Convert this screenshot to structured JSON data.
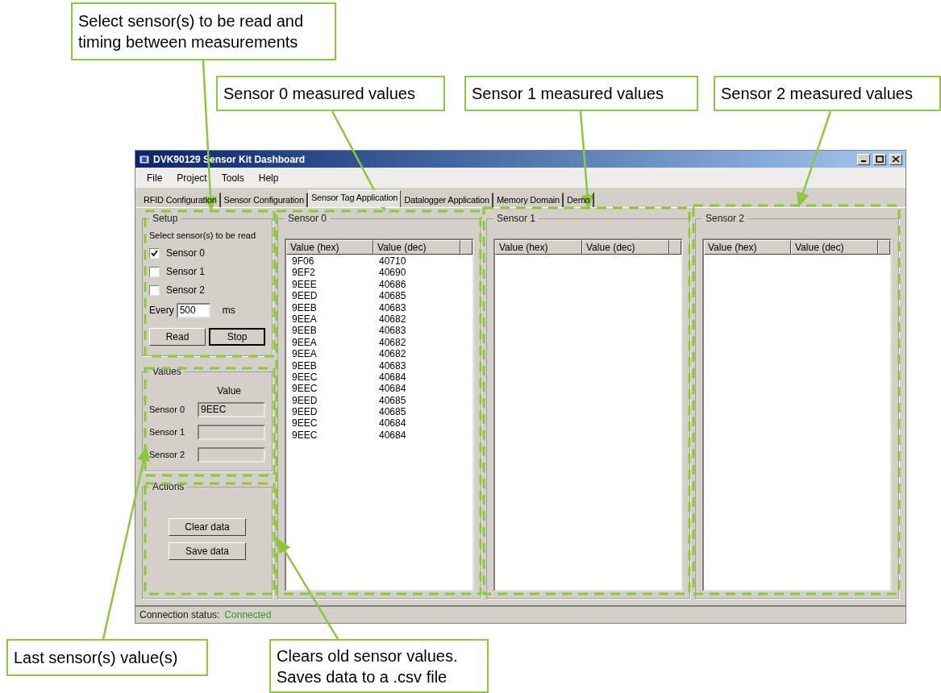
{
  "window": {
    "title": "DVK90129 Sensor Kit Dashboard"
  },
  "menu": [
    "File",
    "Project",
    "Tools",
    "Help"
  ],
  "tabs": [
    {
      "label": "RFID Configuration",
      "selected": false
    },
    {
      "label": "Sensor Configuration",
      "selected": false
    },
    {
      "label": "Sensor Tag Application",
      "selected": true
    },
    {
      "label": "Datalogger Application",
      "selected": false
    },
    {
      "label": "Memory Domain",
      "selected": false
    },
    {
      "label": "Demo",
      "selected": false
    }
  ],
  "setup": {
    "title": "Setup",
    "prompt": "Select sensor(s) to be read",
    "sensors": [
      {
        "label": "Sensor 0",
        "checked": true
      },
      {
        "label": "Sensor 1",
        "checked": false
      },
      {
        "label": "Sensor 2",
        "checked": false
      }
    ],
    "interval_label": "Every",
    "interval": "500",
    "unit": "ms",
    "buttons": [
      {
        "label": "Read",
        "default": false
      },
      {
        "label": "Stop",
        "default": true
      }
    ]
  },
  "values": {
    "title": "Values",
    "header": "Value",
    "rows": [
      {
        "label": "Sensor 0",
        "value": "9EEC"
      },
      {
        "label": "Sensor 1"
      },
      {
        "label": "Sensor 2"
      }
    ]
  },
  "actions": {
    "title": "Actions",
    "buttons": [
      "Clear data",
      "Save data"
    ]
  },
  "sensor_panels": [
    {
      "title": "Sensor 0",
      "columns": [
        "Value (hex)",
        "Value (dec)"
      ],
      "rows": [
        [
          "9F06",
          "40710"
        ],
        [
          "9EF2",
          "40690"
        ],
        [
          "9EEE",
          "40686"
        ],
        [
          "9EED",
          "40685"
        ],
        [
          "9EEB",
          "40683"
        ],
        [
          "9EEA",
          "40682"
        ],
        [
          "9EEB",
          "40683"
        ],
        [
          "9EEA",
          "40682"
        ],
        [
          "9EEA",
          "40682"
        ],
        [
          "9EEB",
          "40683"
        ],
        [
          "9EEC",
          "40684"
        ],
        [
          "9EEC",
          "40684"
        ],
        [
          "9EED",
          "40685"
        ],
        [
          "9EED",
          "40685"
        ],
        [
          "9EEC",
          "40684"
        ],
        [
          "9EEC",
          "40684"
        ]
      ]
    },
    {
      "title": "Sensor 1",
      "columns": [
        "Value (hex)",
        "Value (dec)"
      ]
    },
    {
      "title": "Sensor 2",
      "columns": [
        "Value (hex)",
        "Value (dec)"
      ]
    }
  ],
  "status_bar": {
    "label": "Connection status:",
    "value": "Connected"
  },
  "callouts": [
    {
      "lines": [
        "Select sensor(s) to be read and",
        "timing between measurements"
      ]
    },
    {
      "lines": [
        "Sensor 0 measured values"
      ]
    },
    {
      "lines": [
        "Sensor 1 measured values"
      ]
    },
    {
      "lines": [
        "Sensor 2 measured values"
      ]
    },
    {
      "lines": [
        "Last sensor(s) value(s)"
      ]
    },
    {
      "lines": [
        "Clears old sensor values.",
        "Saves data to a .csv file"
      ]
    }
  ]
}
